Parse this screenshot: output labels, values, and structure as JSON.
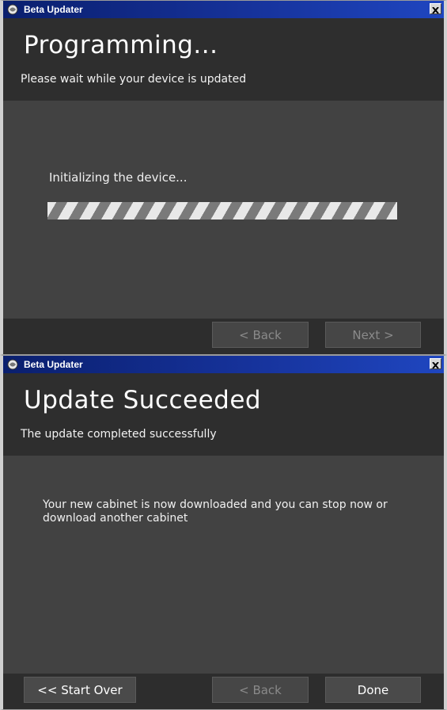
{
  "window1": {
    "title": "Beta Updater",
    "heading": "Programming...",
    "subheading": "Please wait while your device is updated",
    "status": "Initializing the device...",
    "back_label": "< Back",
    "next_label": "Next >"
  },
  "window2": {
    "title": "Beta Updater",
    "heading": "Update Succeeded",
    "subheading": "The update completed successfully",
    "message": "Your new cabinet is now downloaded and you can stop now or download another cabinet",
    "start_over_label": "<< Start Over",
    "back_label": "< Back",
    "done_label": "Done"
  },
  "icons": {
    "app": "beta-updater-icon",
    "close": "close-icon"
  },
  "colors": {
    "titlebar": "#16329a",
    "header_bg": "#2e2e2e",
    "content_bg": "#424242",
    "footer_bg": "#2d2d2d"
  }
}
